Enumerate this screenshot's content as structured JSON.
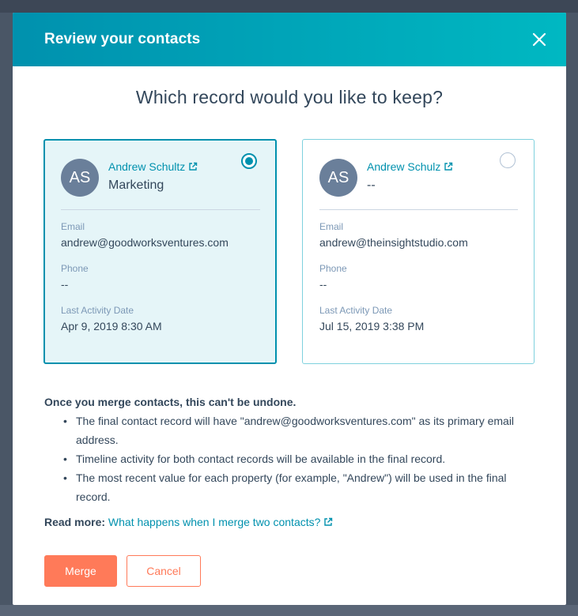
{
  "modal": {
    "title": "Review your contacts",
    "question": "Which record would you like to keep?"
  },
  "records": [
    {
      "initials": "AS",
      "name": "Andrew Schultz",
      "company": "Marketing",
      "email_label": "Email",
      "email": "andrew@goodworksventures.com",
      "phone_label": "Phone",
      "phone": "--",
      "activity_label": "Last Activity Date",
      "activity": "Apr 9, 2019 8:30 AM",
      "selected": true
    },
    {
      "initials": "AS",
      "name": "Andrew Schulz",
      "company": "--",
      "email_label": "Email",
      "email": "andrew@theinsightstudio.com",
      "phone_label": "Phone",
      "phone": "--",
      "activity_label": "Last Activity Date",
      "activity": "Jul 15, 2019 3:38 PM",
      "selected": false
    }
  ],
  "info": {
    "heading": "Once you merge contacts, this can't be undone.",
    "bullets": [
      "The final contact record will have \"andrew@goodworksventures.com\" as its primary email address.",
      "Timeline activity for both contact records will be available in the final record.",
      "The most recent value for each property (for example, \"Andrew\") will be used in the final record."
    ]
  },
  "readmore": {
    "label": "Read more:",
    "link": "What happens when I merge two contacts?"
  },
  "buttons": {
    "merge": "Merge",
    "cancel": "Cancel"
  },
  "colors": {
    "header_gradient_start": "#0091ae",
    "header_gradient_end": "#00b8c2",
    "accent": "#0091ae",
    "primary_button": "#ff7a59",
    "selected_card_bg": "#e5f5f8"
  },
  "icons": {
    "close": "close-icon",
    "external_link": "external-link-icon"
  }
}
